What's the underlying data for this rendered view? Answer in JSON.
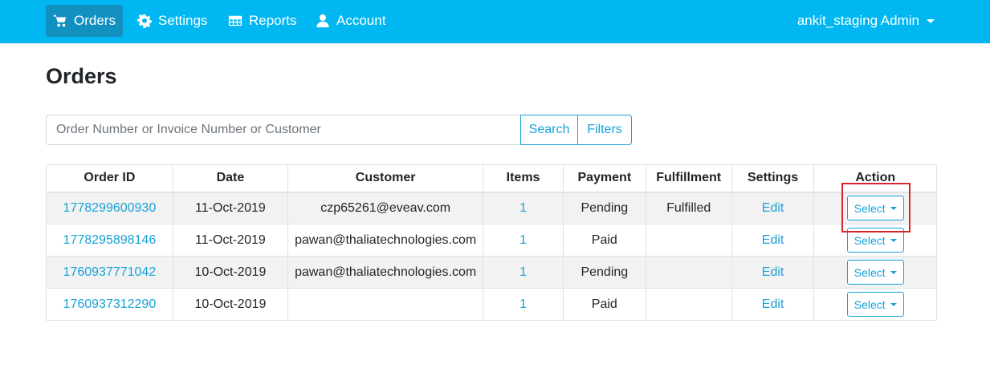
{
  "nav": {
    "items": [
      {
        "label": "Orders",
        "icon": "cart-icon",
        "active": true
      },
      {
        "label": "Settings",
        "icon": "gear-icon",
        "active": false
      },
      {
        "label": "Reports",
        "icon": "table-icon",
        "active": false
      },
      {
        "label": "Account",
        "icon": "user-icon",
        "active": false
      }
    ],
    "user": "ankit_staging Admin"
  },
  "page": {
    "title": "Orders"
  },
  "search": {
    "placeholder": "Order Number or Invoice Number or Customer",
    "value": "",
    "search_label": "Search",
    "filters_label": "Filters"
  },
  "table": {
    "columns": [
      "Order ID",
      "Date",
      "Customer",
      "Items",
      "Payment",
      "Fulfillment",
      "Settings",
      "Action"
    ],
    "rows": [
      {
        "order_id": "1778299600930",
        "date": "11-Oct-2019",
        "customer": "czp65261@eveav.com",
        "items": "1",
        "payment": "Pending",
        "fulfillment": "Fulfilled",
        "settings": "Edit",
        "action": "Select"
      },
      {
        "order_id": "1778295898146",
        "date": "11-Oct-2019",
        "customer": "pawan@thaliatechnologies.com",
        "items": "1",
        "payment": "Paid",
        "fulfillment": "",
        "settings": "Edit",
        "action": "Select"
      },
      {
        "order_id": "1760937771042",
        "date": "10-Oct-2019",
        "customer": "pawan@thaliatechnologies.com",
        "items": "1",
        "payment": "Pending",
        "fulfillment": "",
        "settings": "Edit",
        "action": "Select"
      },
      {
        "order_id": "1760937312290",
        "date": "10-Oct-2019",
        "customer": "",
        "items": "1",
        "payment": "Paid",
        "fulfillment": "",
        "settings": "Edit",
        "action": "Select"
      }
    ]
  },
  "colors": {
    "navbar": "#00b7f1",
    "nav_active": "#1291c1",
    "accent": "#17a2d8",
    "highlight": "#d9262e"
  }
}
